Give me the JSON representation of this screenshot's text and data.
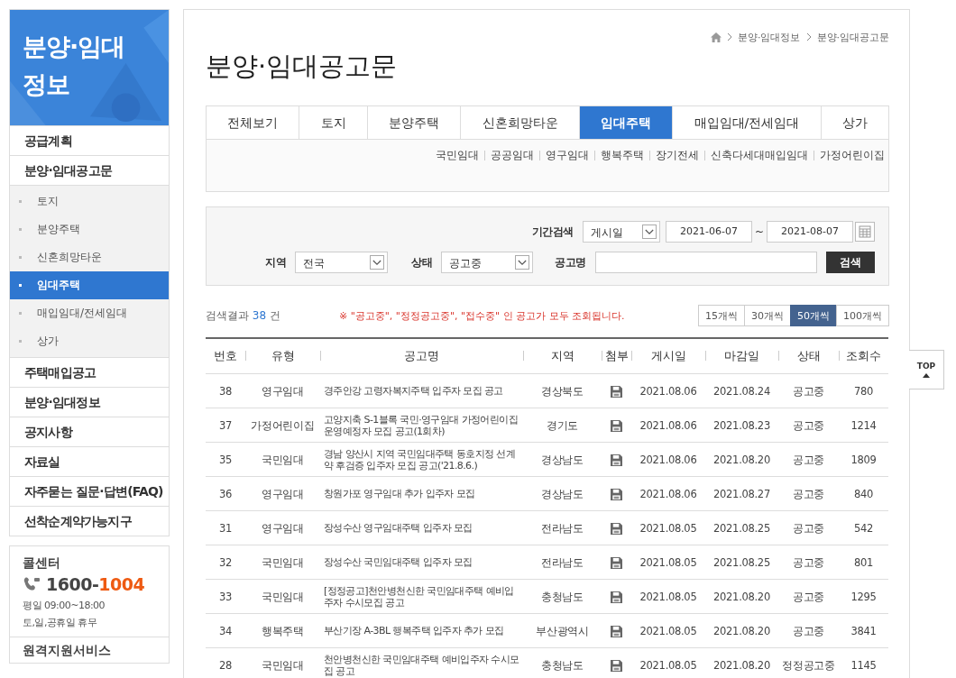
{
  "sidebar": {
    "title": "분양·임대정보",
    "items": [
      {
        "label": "공급계획",
        "selected": false
      },
      {
        "label": "분양·임대공고문",
        "selected": false,
        "children": [
          {
            "label": "토지",
            "selected": false
          },
          {
            "label": "분양주택",
            "selected": false
          },
          {
            "label": "신혼희망타운",
            "selected": false
          },
          {
            "label": "임대주택",
            "selected": true
          },
          {
            "label": "매입임대/전세임대",
            "selected": false
          },
          {
            "label": "상가",
            "selected": false
          }
        ]
      },
      {
        "label": "주택매입공고",
        "selected": false
      },
      {
        "label": "분양·임대정보",
        "selected": false
      },
      {
        "label": "공지사항",
        "selected": false
      },
      {
        "label": "자료실",
        "selected": false
      },
      {
        "label": "자주묻는 질문·답변(FAQ)",
        "selected": false
      },
      {
        "label": "선착순계약가능지구",
        "selected": false
      }
    ],
    "callcenter": {
      "title": "콜센터",
      "phone_prefix": "1600-",
      "phone_suffix": "1004",
      "hours": "평일 09:00~18:00",
      "closed": "토,일,공휴일 휴무"
    },
    "remote": "원격지원서비스"
  },
  "breadcrumb": [
    "분양·임대정보",
    "분양·임대공고문"
  ],
  "page_title": "분양·임대공고문",
  "tabs": [
    {
      "label": "전체보기",
      "selected": false
    },
    {
      "label": "토지",
      "selected": false
    },
    {
      "label": "분양주택",
      "selected": false
    },
    {
      "label": "신혼희망타운",
      "selected": false
    },
    {
      "label": "임대주택",
      "selected": true
    },
    {
      "label": "매입임대/전세임대",
      "selected": false
    },
    {
      "label": "상가",
      "selected": false
    }
  ],
  "subtabs": [
    "국민임대",
    "공공임대",
    "영구임대",
    "행복주택",
    "장기전세",
    "신축다세대매입임대",
    "가정어린이집"
  ],
  "search": {
    "period_label": "기간검색",
    "period_type": "게시일",
    "date_from": "2021-06-07",
    "date_sep": "~",
    "date_to": "2021-08-07",
    "region_label": "지역",
    "region": "전국",
    "status_label": "상태",
    "status": "공고중",
    "name_label": "공고명",
    "button": "검색"
  },
  "result": {
    "prefix": "검색결과",
    "count": "38",
    "suffix": "건",
    "notice": "※ \"공고중\", \"정정공고중\", \"접수중\" 인 공고가 모두 조회됩니다."
  },
  "page_sizes": [
    {
      "label": "15개씩",
      "selected": false
    },
    {
      "label": "30개씩",
      "selected": false
    },
    {
      "label": "50개씩",
      "selected": true
    },
    {
      "label": "100개씩",
      "selected": false
    }
  ],
  "table": {
    "columns": [
      "번호",
      "유형",
      "공고명",
      "지역",
      "첨부",
      "게시일",
      "마감일",
      "상태",
      "조회수"
    ],
    "rows": [
      {
        "no": "38",
        "type": "영구임대",
        "title": "경주안강 고령자복지주택 입주자 모집 공고",
        "region": "경상북도",
        "attachment": true,
        "posted": "2021.08.06",
        "deadline": "2021.08.24",
        "status": "공고중",
        "views": "780"
      },
      {
        "no": "37",
        "type": "가정어린이집",
        "title": "고양지축 S-1블록 국민·영구임대 가정어린이집 운영예정자 모집 공고(1회차)",
        "region": "경기도",
        "attachment": true,
        "posted": "2021.08.06",
        "deadline": "2021.08.23",
        "status": "공고중",
        "views": "1214"
      },
      {
        "no": "35",
        "type": "국민임대",
        "title": "경남 양산시 지역 국민임대주택 동호지정 선계약 후검증 입주자 모집 공고('21.8.6.)",
        "region": "경상남도",
        "attachment": true,
        "posted": "2021.08.06",
        "deadline": "2021.08.20",
        "status": "공고중",
        "views": "1809"
      },
      {
        "no": "36",
        "type": "영구임대",
        "title": "창원가포 영구임대 추가 입주자 모집",
        "region": "경상남도",
        "attachment": true,
        "posted": "2021.08.06",
        "deadline": "2021.08.27",
        "status": "공고중",
        "views": "840"
      },
      {
        "no": "31",
        "type": "영구임대",
        "title": "장성수산 영구임대주택 입주자 모집",
        "region": "전라남도",
        "attachment": true,
        "posted": "2021.08.05",
        "deadline": "2021.08.25",
        "status": "공고중",
        "views": "542"
      },
      {
        "no": "32",
        "type": "국민임대",
        "title": "장성수산 국민임대주택 입주자 모집",
        "region": "전라남도",
        "attachment": true,
        "posted": "2021.08.05",
        "deadline": "2021.08.25",
        "status": "공고중",
        "views": "801"
      },
      {
        "no": "33",
        "type": "국민임대",
        "title": "[정정공고]천안병천신한 국민임대주택 예비입주자 수시모집 공고",
        "region": "충청남도",
        "attachment": true,
        "posted": "2021.08.05",
        "deadline": "2021.08.20",
        "status": "공고중",
        "views": "1295"
      },
      {
        "no": "34",
        "type": "행복주택",
        "title": "부산기장 A-3BL 행복주택 입주자 추가 모집",
        "region": "부산광역시",
        "attachment": true,
        "posted": "2021.08.05",
        "deadline": "2021.08.20",
        "status": "공고중",
        "views": "3841"
      },
      {
        "no": "28",
        "type": "국민임대",
        "title": "천안병천신한 국민임대주택 예비입주자 수시모집 공고",
        "region": "충청남도",
        "attachment": true,
        "posted": "2021.08.05",
        "deadline": "2021.08.20",
        "status": "정정공고중",
        "views": "1145"
      }
    ]
  },
  "top_button": "TOP"
}
